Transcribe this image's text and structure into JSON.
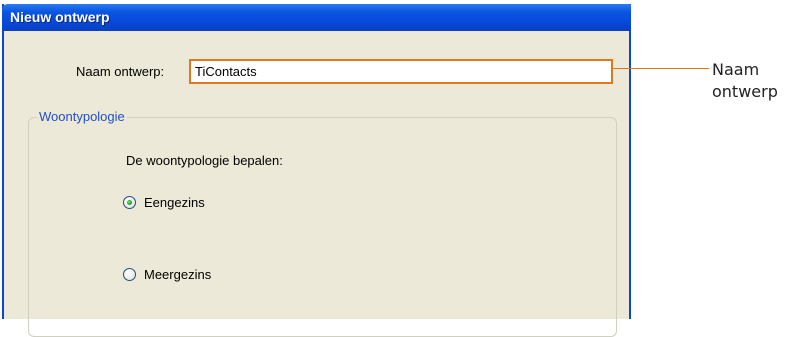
{
  "window": {
    "title": "Nieuw ontwerp"
  },
  "name_field": {
    "label": "Naam ontwerp:",
    "value": "TiContacts"
  },
  "group": {
    "legend": "Woontypologie",
    "prompt": "De woontypologie bepalen:",
    "options": [
      {
        "label": "Eengezins",
        "checked": true
      },
      {
        "label": "Meergezins",
        "checked": false
      }
    ]
  },
  "callout": {
    "line1": "Naam",
    "line2": "ontwerp",
    "color": "#e0781f"
  },
  "colors": {
    "titlebar": "#0a55e0",
    "window_bg": "#ece9d8",
    "legend_text": "#2050c8"
  }
}
